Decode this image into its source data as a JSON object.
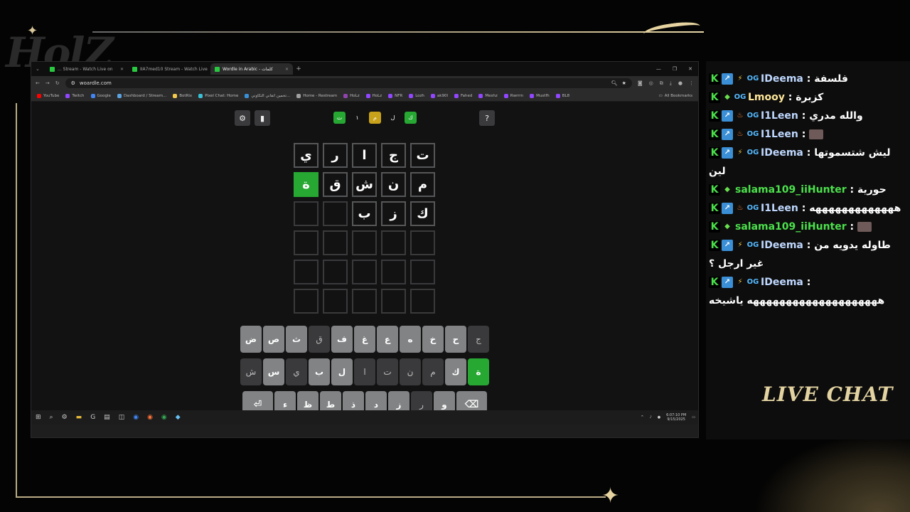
{
  "overlay": {
    "logo": "HolZ",
    "live_chat": "LIVE CHAT"
  },
  "browser": {
    "tabs": [
      {
        "title": "... Stream - Watch Live on",
        "active": false
      },
      {
        "title": "IIA7med10 Stream - Watch Live",
        "active": false
      },
      {
        "title": "Wordle in Arabic - كلمات",
        "active": true
      }
    ],
    "url": "woardle.com",
    "bookmarks": [
      "YouTube",
      "Twitch",
      "Google",
      "Dashboard / Stream...",
      "BotRix",
      "Pixel Chat: Home",
      "تخمين اتقاني التكاوني...",
      "Home - Restream",
      "HoLz",
      "HoLz",
      "NFR",
      "Lozh",
      "ak90l",
      "Fahed",
      "Meshz",
      "Rwrrrn",
      "Mustfh",
      "BL8"
    ],
    "all_bookmarks": "All Bookmarks"
  },
  "game": {
    "mini_tiles": [
      {
        "letter": "ت",
        "color": "#26a833"
      },
      {
        "letter": "١",
        "color": ""
      },
      {
        "letter": "م",
        "color": "#c9a21b"
      },
      {
        "letter": "ل",
        "color": ""
      },
      {
        "letter": "ك",
        "color": "#26a833"
      }
    ],
    "board": [
      [
        {
          "l": "ت",
          "s": "filled"
        },
        {
          "l": "ج",
          "s": "filled"
        },
        {
          "l": "ا",
          "s": "filled"
        },
        {
          "l": "ر",
          "s": "filled"
        },
        {
          "l": "ي",
          "s": "filled"
        }
      ],
      [
        {
          "l": "م",
          "s": "filled"
        },
        {
          "l": "ن",
          "s": "filled"
        },
        {
          "l": "ش",
          "s": "filled"
        },
        {
          "l": "ق",
          "s": "filled"
        },
        {
          "l": "ة",
          "s": "correct"
        }
      ],
      [
        {
          "l": "ك",
          "s": "filled"
        },
        {
          "l": "ز",
          "s": "filled"
        },
        {
          "l": "ب",
          "s": "filled"
        },
        {
          "l": "",
          "s": "empty"
        },
        {
          "l": "",
          "s": "empty"
        }
      ],
      [
        {
          "l": "",
          "s": "empty"
        },
        {
          "l": "",
          "s": "empty"
        },
        {
          "l": "",
          "s": "empty"
        },
        {
          "l": "",
          "s": "empty"
        },
        {
          "l": "",
          "s": "empty"
        }
      ],
      [
        {
          "l": "",
          "s": "empty"
        },
        {
          "l": "",
          "s": "empty"
        },
        {
          "l": "",
          "s": "empty"
        },
        {
          "l": "",
          "s": "empty"
        },
        {
          "l": "",
          "s": "empty"
        }
      ],
      [
        {
          "l": "",
          "s": "empty"
        },
        {
          "l": "",
          "s": "empty"
        },
        {
          "l": "",
          "s": "empty"
        },
        {
          "l": "",
          "s": "empty"
        },
        {
          "l": "",
          "s": "empty"
        }
      ]
    ],
    "keyboard": [
      [
        {
          "k": "ج",
          "s": "absent"
        },
        {
          "k": "ح",
          "s": "normal"
        },
        {
          "k": "خ",
          "s": "normal"
        },
        {
          "k": "ه",
          "s": "normal"
        },
        {
          "k": "ع",
          "s": "normal"
        },
        {
          "k": "غ",
          "s": "normal"
        },
        {
          "k": "ف",
          "s": "normal"
        },
        {
          "k": "ق",
          "s": "absent"
        },
        {
          "k": "ث",
          "s": "normal"
        },
        {
          "k": "ص",
          "s": "normal"
        },
        {
          "k": "ض",
          "s": "normal"
        }
      ],
      [
        {
          "k": "ة",
          "s": "correct"
        },
        {
          "k": "ك",
          "s": "normal"
        },
        {
          "k": "م",
          "s": "absent"
        },
        {
          "k": "ن",
          "s": "absent"
        },
        {
          "k": "ت",
          "s": "absent"
        },
        {
          "k": "ا",
          "s": "absent"
        },
        {
          "k": "ل",
          "s": "normal"
        },
        {
          "k": "ب",
          "s": "normal"
        },
        {
          "k": "ي",
          "s": "absent"
        },
        {
          "k": "س",
          "s": "normal"
        },
        {
          "k": "ش",
          "s": "absent"
        }
      ],
      [
        {
          "k": "⌫",
          "s": "wide"
        },
        {
          "k": "و",
          "s": "normal"
        },
        {
          "k": "ر",
          "s": "absent"
        },
        {
          "k": "ز",
          "s": "normal"
        },
        {
          "k": "د",
          "s": "normal"
        },
        {
          "k": "ذ",
          "s": "normal"
        },
        {
          "k": "ط",
          "s": "normal"
        },
        {
          "k": "ظ",
          "s": "normal"
        },
        {
          "k": "ء",
          "s": "normal"
        },
        {
          "k": "⏎",
          "s": "wide"
        }
      ]
    ]
  },
  "taskbar": {
    "time": "6:07:10 PM",
    "date": "9/15/2025"
  },
  "chat": {
    "messages": [
      {
        "badges": [
          "k",
          "sub",
          "bolt",
          "og"
        ],
        "user": "IDeema",
        "ucls": "",
        "text": "فلسفة"
      },
      {
        "badges": [
          "k",
          "gem",
          "og"
        ],
        "user": "Lmooy",
        "ucls": "gold",
        "text": "كزبرة"
      },
      {
        "badges": [
          "k",
          "sub",
          "fire",
          "og"
        ],
        "user": "I1Leen",
        "ucls": "",
        "text": "والله مدري"
      },
      {
        "badges": [
          "k",
          "sub",
          "fire",
          "og"
        ],
        "user": "I1Leen",
        "ucls": "",
        "text": "",
        "emote": true
      },
      {
        "badges": [
          "k",
          "sub",
          "bolt",
          "og"
        ],
        "user": "IDeema",
        "ucls": "",
        "text": "ليش شتسموتها لين"
      },
      {
        "badges": [
          "k",
          "gem"
        ],
        "user": "salama109_iiHunter",
        "ucls": "green",
        "text": "حورية"
      },
      {
        "badges": [
          "k",
          "sub",
          "fire",
          "og"
        ],
        "user": "I1Leen",
        "ucls": "",
        "text": "هههههههههههههه"
      },
      {
        "badges": [
          "k",
          "gem"
        ],
        "user": "salama109_iiHunter",
        "ucls": "green",
        "text": "",
        "emote": true
      },
      {
        "badges": [
          "k",
          "sub",
          "bolt",
          "og"
        ],
        "user": "IDeema",
        "ucls": "",
        "text": "طاوله يدويه من غير ارجل ؟"
      },
      {
        "badges": [
          "k",
          "sub",
          "bolt",
          "og"
        ],
        "user": "IDeema",
        "ucls": "",
        "text": "ههههههههههههههههههههه ياشيخه"
      }
    ]
  }
}
